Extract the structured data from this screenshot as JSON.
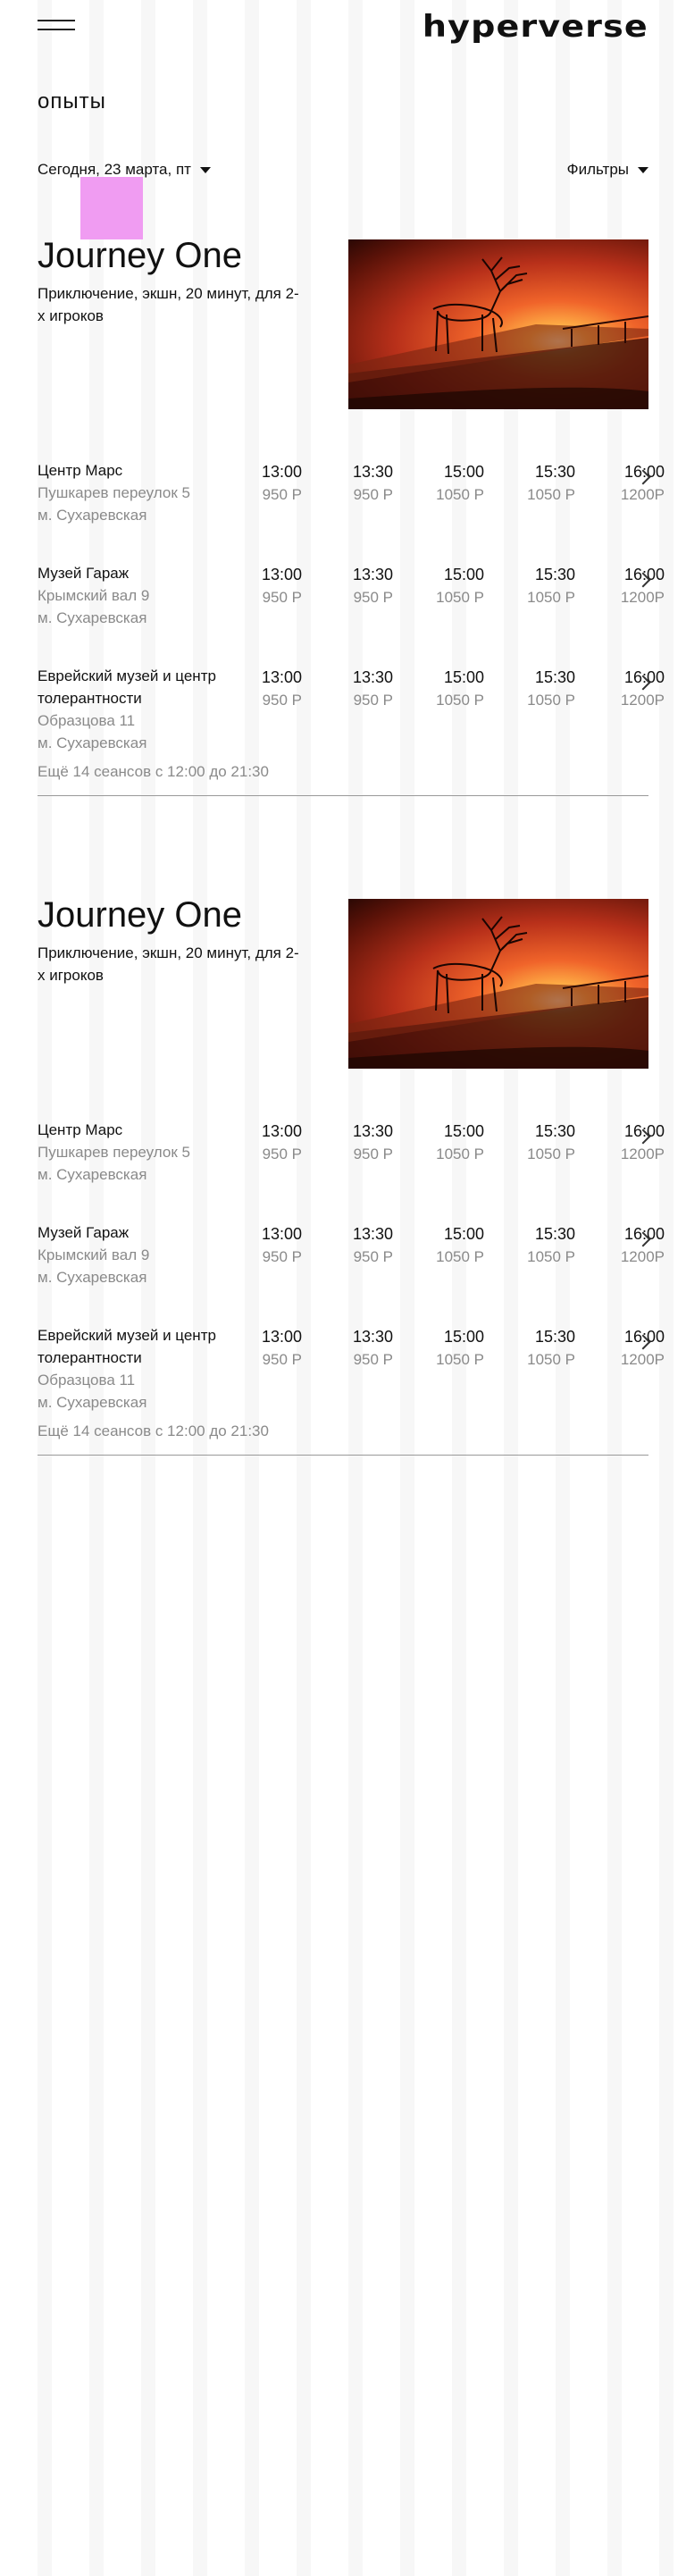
{
  "header": {
    "logo": "hyperverse"
  },
  "page": {
    "title": "опыты"
  },
  "controls": {
    "date": "Сегодня, 23 марта, пт",
    "filters": "Фильтры"
  },
  "experiences": [
    {
      "title": "Journey One",
      "description": "Приключение, экшн, 20 минут, для 2-х игроков",
      "venues": [
        {
          "name": "Центр Марс",
          "address": [
            "Пушкарев переулок 5",
            "м. Сухаревская"
          ],
          "sessions": [
            {
              "time": "13:00",
              "price": "950 Р"
            },
            {
              "time": "13:30",
              "price": "950 Р"
            },
            {
              "time": "15:00",
              "price": "1050 Р"
            },
            {
              "time": "15:30",
              "price": "1050 Р"
            },
            {
              "time": "16:00",
              "price": "1200Р"
            }
          ]
        },
        {
          "name": "Музей Гараж",
          "address": [
            "Крымский вал 9",
            "м. Сухаревская"
          ],
          "sessions": [
            {
              "time": "13:00",
              "price": "950 Р"
            },
            {
              "time": "13:30",
              "price": "950 Р"
            },
            {
              "time": "15:00",
              "price": "1050 Р"
            },
            {
              "time": "15:30",
              "price": "1050 Р"
            },
            {
              "time": "16:00",
              "price": "1200Р"
            }
          ]
        },
        {
          "name": "Еврейский музей и центр толерантности",
          "address": [
            "Образцова 11",
            "м. Сухаревская"
          ],
          "sessions": [
            {
              "time": "13:00",
              "price": "950 Р"
            },
            {
              "time": "13:30",
              "price": "950 Р"
            },
            {
              "time": "15:00",
              "price": "1050 Р"
            },
            {
              "time": "15:30",
              "price": "1050 Р"
            },
            {
              "time": "16:00",
              "price": "1200Р"
            }
          ]
        }
      ],
      "more": "Ещё 14 сеансов с 12:00 до 21:30"
    },
    {
      "title": "Journey One",
      "description": "Приключение, экшн, 20 минут, для 2-х игроков",
      "venues": [
        {
          "name": "Центр Марс",
          "address": [
            "Пушкарев переулок 5",
            "м. Сухаревская"
          ],
          "sessions": [
            {
              "time": "13:00",
              "price": "950 Р"
            },
            {
              "time": "13:30",
              "price": "950 Р"
            },
            {
              "time": "15:00",
              "price": "1050 Р"
            },
            {
              "time": "15:30",
              "price": "1050 Р"
            },
            {
              "time": "16:00",
              "price": "1200Р"
            }
          ]
        },
        {
          "name": "Музей Гараж",
          "address": [
            "Крымский вал 9",
            "м. Сухаревская"
          ],
          "sessions": [
            {
              "time": "13:00",
              "price": "950 Р"
            },
            {
              "time": "13:30",
              "price": "950 Р"
            },
            {
              "time": "15:00",
              "price": "1050 Р"
            },
            {
              "time": "15:30",
              "price": "1050 Р"
            },
            {
              "time": "16:00",
              "price": "1200Р"
            }
          ]
        },
        {
          "name": "Еврейский музей и центр толерантности",
          "address": [
            "Образцова 11",
            "м. Сухаревская"
          ],
          "sessions": [
            {
              "time": "13:00",
              "price": "950 Р"
            },
            {
              "time": "13:30",
              "price": "950 Р"
            },
            {
              "time": "15:00",
              "price": "1050 Р"
            },
            {
              "time": "15:30",
              "price": "1050 Р"
            },
            {
              "time": "16:00",
              "price": "1200Р"
            }
          ]
        }
      ],
      "more": "Ещё 14 сеансов с 12:00 до 21:30"
    }
  ],
  "icons": {
    "menu": "hamburger-menu-icon",
    "caret": "caret-down-icon",
    "chevron": "chevron-right-icon"
  },
  "colors": {
    "accent_pink": "#f09cf2",
    "text": "#111111",
    "muted": "#8a8a8a"
  }
}
